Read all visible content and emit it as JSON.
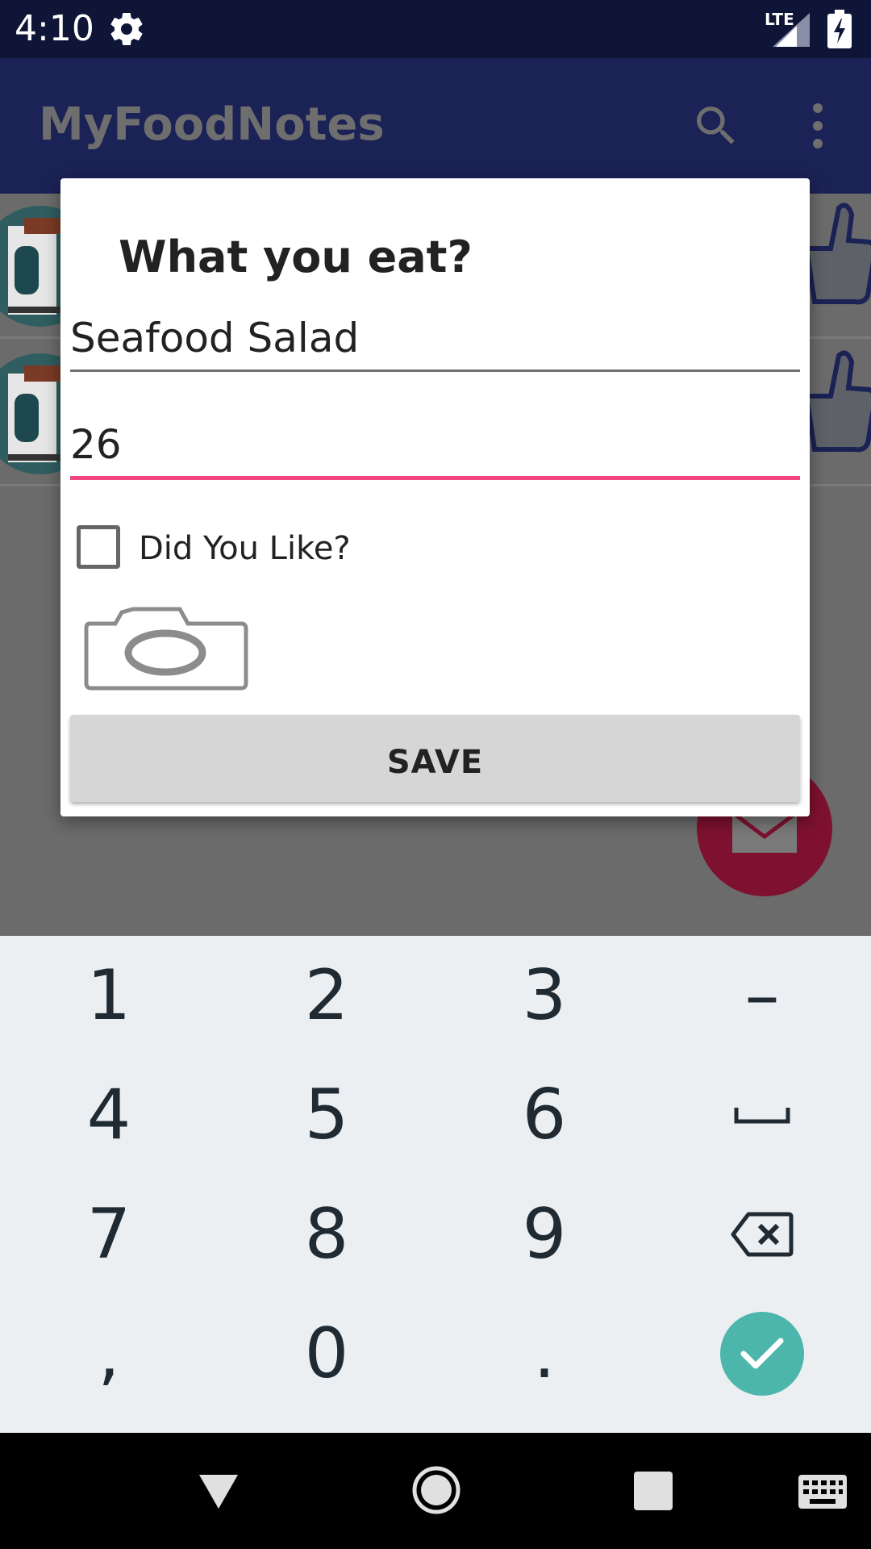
{
  "status_bar": {
    "time": "4:10",
    "network_label": "LTE",
    "icons": [
      "gear-icon",
      "signal-icon",
      "battery-charging-icon"
    ]
  },
  "app_bar": {
    "title": "MyFoodNotes",
    "icons": [
      "search-icon",
      "more-vert-icon"
    ]
  },
  "dialog": {
    "title": "What you eat?",
    "food_name_value": "Seafood Salad",
    "price_value": "26",
    "checkbox_label": "Did You Like?",
    "checkbox_checked": false,
    "camera_icon": "camera-icon",
    "save_label": "SAVE",
    "accent_color": "#f0457d"
  },
  "keyboard": {
    "rows": [
      [
        "1",
        "2",
        "3",
        "–"
      ],
      [
        "4",
        "5",
        "6",
        "space"
      ],
      [
        "7",
        "8",
        "9",
        "backspace"
      ],
      [
        ",",
        "0",
        ".",
        "enter"
      ]
    ],
    "enter_color": "#4db6ac"
  },
  "nav_bar": {
    "icons": [
      "back-icon",
      "home-icon",
      "recents-icon",
      "keyboard-switch-icon"
    ]
  },
  "colors": {
    "status_bar": "#0f1537",
    "app_bar": "#1b2255",
    "fab": "#7e1130"
  }
}
